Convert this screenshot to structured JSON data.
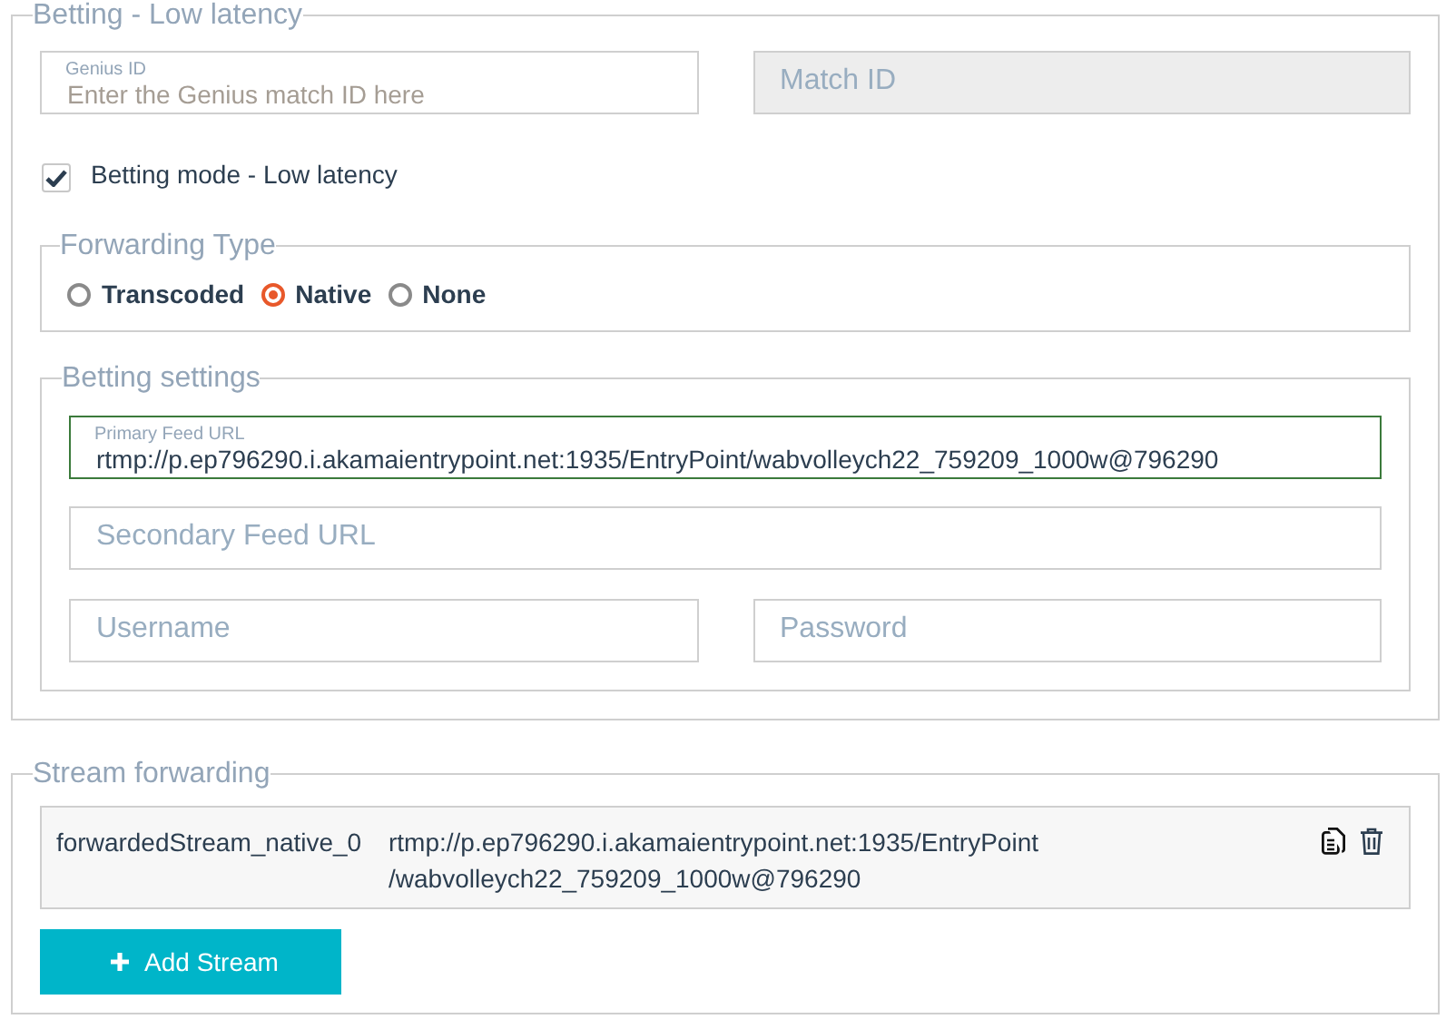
{
  "betting": {
    "legend": "Betting - Low latency",
    "genius_id": {
      "label": "Genius ID",
      "placeholder": "Enter the Genius match ID here"
    },
    "match_id": {
      "placeholder": "Match ID",
      "disabled": true
    },
    "betting_mode": {
      "label": "Betting mode - Low latency",
      "checked": true
    },
    "forwarding_type": {
      "legend": "Forwarding Type",
      "options": [
        {
          "label": "Transcoded",
          "selected": false
        },
        {
          "label": "Native",
          "selected": true
        },
        {
          "label": "None",
          "selected": false
        }
      ]
    },
    "betting_settings": {
      "legend": "Betting settings",
      "primary_feed": {
        "label": "Primary Feed URL",
        "value": "rtmp://p.ep796290.i.akamaientrypoint.net:1935/EntryPoint/wabvolleych22_759209_1000w@796290",
        "focused": true
      },
      "secondary_feed": {
        "placeholder": "Secondary Feed URL"
      },
      "username": {
        "placeholder": "Username"
      },
      "password": {
        "placeholder": "Password"
      }
    }
  },
  "stream_forwarding": {
    "legend": "Stream forwarding",
    "streams": [
      {
        "name": "forwardedStream_native_0",
        "url": "rtmp://p.ep796290.i.akamaientrypoint.net:1935/EntryPoint/wabvolleych22_759209_1000w@796290"
      }
    ],
    "add_button": "Add Stream"
  }
}
